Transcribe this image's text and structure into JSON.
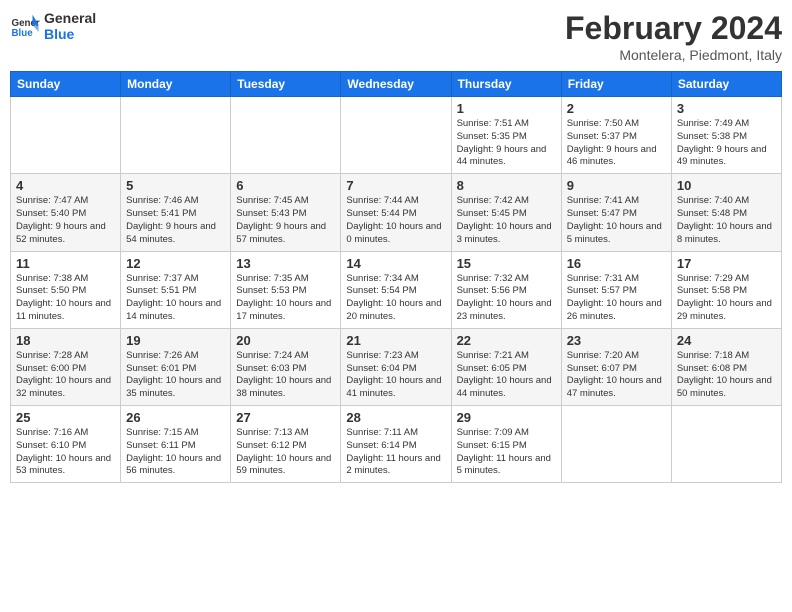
{
  "logo": {
    "text_general": "General",
    "text_blue": "Blue"
  },
  "header": {
    "title": "February 2024",
    "subtitle": "Montelera, Piedmont, Italy"
  },
  "weekdays": [
    "Sunday",
    "Monday",
    "Tuesday",
    "Wednesday",
    "Thursday",
    "Friday",
    "Saturday"
  ],
  "weeks": [
    {
      "bg": "row-bg-1",
      "days": [
        {
          "num": "",
          "info": ""
        },
        {
          "num": "",
          "info": ""
        },
        {
          "num": "",
          "info": ""
        },
        {
          "num": "",
          "info": ""
        },
        {
          "num": "1",
          "info": "Sunrise: 7:51 AM\nSunset: 5:35 PM\nDaylight: 9 hours\nand 44 minutes."
        },
        {
          "num": "2",
          "info": "Sunrise: 7:50 AM\nSunset: 5:37 PM\nDaylight: 9 hours\nand 46 minutes."
        },
        {
          "num": "3",
          "info": "Sunrise: 7:49 AM\nSunset: 5:38 PM\nDaylight: 9 hours\nand 49 minutes."
        }
      ]
    },
    {
      "bg": "row-bg-2",
      "days": [
        {
          "num": "4",
          "info": "Sunrise: 7:47 AM\nSunset: 5:40 PM\nDaylight: 9 hours\nand 52 minutes."
        },
        {
          "num": "5",
          "info": "Sunrise: 7:46 AM\nSunset: 5:41 PM\nDaylight: 9 hours\nand 54 minutes."
        },
        {
          "num": "6",
          "info": "Sunrise: 7:45 AM\nSunset: 5:43 PM\nDaylight: 9 hours\nand 57 minutes."
        },
        {
          "num": "7",
          "info": "Sunrise: 7:44 AM\nSunset: 5:44 PM\nDaylight: 10 hours\nand 0 minutes."
        },
        {
          "num": "8",
          "info": "Sunrise: 7:42 AM\nSunset: 5:45 PM\nDaylight: 10 hours\nand 3 minutes."
        },
        {
          "num": "9",
          "info": "Sunrise: 7:41 AM\nSunset: 5:47 PM\nDaylight: 10 hours\nand 5 minutes."
        },
        {
          "num": "10",
          "info": "Sunrise: 7:40 AM\nSunset: 5:48 PM\nDaylight: 10 hours\nand 8 minutes."
        }
      ]
    },
    {
      "bg": "row-bg-1",
      "days": [
        {
          "num": "11",
          "info": "Sunrise: 7:38 AM\nSunset: 5:50 PM\nDaylight: 10 hours\nand 11 minutes."
        },
        {
          "num": "12",
          "info": "Sunrise: 7:37 AM\nSunset: 5:51 PM\nDaylight: 10 hours\nand 14 minutes."
        },
        {
          "num": "13",
          "info": "Sunrise: 7:35 AM\nSunset: 5:53 PM\nDaylight: 10 hours\nand 17 minutes."
        },
        {
          "num": "14",
          "info": "Sunrise: 7:34 AM\nSunset: 5:54 PM\nDaylight: 10 hours\nand 20 minutes."
        },
        {
          "num": "15",
          "info": "Sunrise: 7:32 AM\nSunset: 5:56 PM\nDaylight: 10 hours\nand 23 minutes."
        },
        {
          "num": "16",
          "info": "Sunrise: 7:31 AM\nSunset: 5:57 PM\nDaylight: 10 hours\nand 26 minutes."
        },
        {
          "num": "17",
          "info": "Sunrise: 7:29 AM\nSunset: 5:58 PM\nDaylight: 10 hours\nand 29 minutes."
        }
      ]
    },
    {
      "bg": "row-bg-2",
      "days": [
        {
          "num": "18",
          "info": "Sunrise: 7:28 AM\nSunset: 6:00 PM\nDaylight: 10 hours\nand 32 minutes."
        },
        {
          "num": "19",
          "info": "Sunrise: 7:26 AM\nSunset: 6:01 PM\nDaylight: 10 hours\nand 35 minutes."
        },
        {
          "num": "20",
          "info": "Sunrise: 7:24 AM\nSunset: 6:03 PM\nDaylight: 10 hours\nand 38 minutes."
        },
        {
          "num": "21",
          "info": "Sunrise: 7:23 AM\nSunset: 6:04 PM\nDaylight: 10 hours\nand 41 minutes."
        },
        {
          "num": "22",
          "info": "Sunrise: 7:21 AM\nSunset: 6:05 PM\nDaylight: 10 hours\nand 44 minutes."
        },
        {
          "num": "23",
          "info": "Sunrise: 7:20 AM\nSunset: 6:07 PM\nDaylight: 10 hours\nand 47 minutes."
        },
        {
          "num": "24",
          "info": "Sunrise: 7:18 AM\nSunset: 6:08 PM\nDaylight: 10 hours\nand 50 minutes."
        }
      ]
    },
    {
      "bg": "row-bg-1",
      "days": [
        {
          "num": "25",
          "info": "Sunrise: 7:16 AM\nSunset: 6:10 PM\nDaylight: 10 hours\nand 53 minutes."
        },
        {
          "num": "26",
          "info": "Sunrise: 7:15 AM\nSunset: 6:11 PM\nDaylight: 10 hours\nand 56 minutes."
        },
        {
          "num": "27",
          "info": "Sunrise: 7:13 AM\nSunset: 6:12 PM\nDaylight: 10 hours\nand 59 minutes."
        },
        {
          "num": "28",
          "info": "Sunrise: 7:11 AM\nSunset: 6:14 PM\nDaylight: 11 hours\nand 2 minutes."
        },
        {
          "num": "29",
          "info": "Sunrise: 7:09 AM\nSunset: 6:15 PM\nDaylight: 11 hours\nand 5 minutes."
        },
        {
          "num": "",
          "info": ""
        },
        {
          "num": "",
          "info": ""
        }
      ]
    }
  ]
}
